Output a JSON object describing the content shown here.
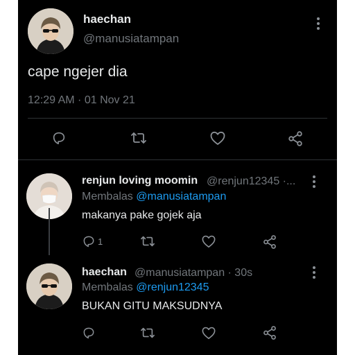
{
  "main_tweet": {
    "display_name": "haechan",
    "handle": "@manusiatampan",
    "text": "cape ngejer dia",
    "timestamp": "12:29 AM · 01 Nov 21",
    "actions": [
      "reply-icon",
      "retweet-icon",
      "like-icon",
      "share-icon"
    ]
  },
  "replies": [
    {
      "display_name": "renjun loving moomin",
      "handle_suffix": "@renjun12345 ·...",
      "replying_prefix": "Membalas",
      "replying_to": "@manusiatampan",
      "text": "makanya pake gojek aja",
      "reply_count": "1"
    },
    {
      "display_name": "haechan",
      "handle_suffix": "@manusiatampan · 30s",
      "replying_prefix": "Membalas",
      "replying_to": "@renjun12345",
      "text": "BUKAN GITU MAKSUDNYA",
      "reply_count": ""
    }
  ],
  "colors": {
    "background": "#000000",
    "text": "#e7e9ea",
    "muted": "#71767b",
    "link": "#1d9bf0",
    "divider": "#2f3336"
  }
}
